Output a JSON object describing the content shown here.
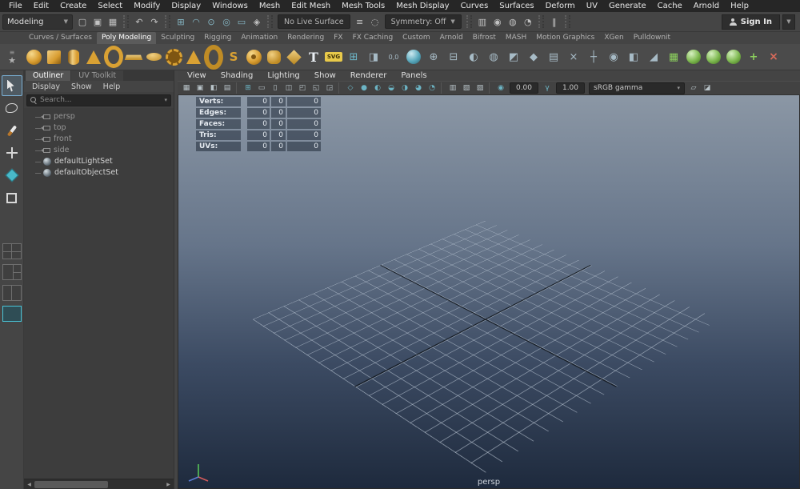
{
  "menubar": {
    "items": [
      "File",
      "Edit",
      "Create",
      "Select",
      "Modify",
      "Display",
      "Windows",
      "Mesh",
      "Edit Mesh",
      "Mesh Tools",
      "Mesh Display",
      "Curves",
      "Surfaces",
      "Deform",
      "UV",
      "Generate",
      "Cache",
      "Arnold",
      "Help"
    ]
  },
  "statusline": {
    "menu_set": "Modeling",
    "live_surface": "No Live Surface",
    "symmetry": "Symmetry: Off",
    "sign_in": "Sign In",
    "icons_a": [
      {
        "name": "new-scene-icon",
        "cls": "",
        "glyph": "▢"
      },
      {
        "name": "open-scene-icon",
        "cls": "",
        "glyph": "▣"
      },
      {
        "name": "save-scene-icon",
        "cls": "",
        "glyph": "▦"
      },
      {
        "name": "grip",
        "cls": "grip",
        "glyph": ""
      },
      {
        "name": "undo-icon",
        "cls": "",
        "glyph": "↶"
      },
      {
        "name": "redo-icon",
        "cls": "",
        "glyph": "↷"
      },
      {
        "name": "grip",
        "cls": "grip",
        "glyph": ""
      },
      {
        "name": "snap-to-grid-icon",
        "cls": "teal",
        "glyph": "⊞"
      },
      {
        "name": "snap-to-curve-icon",
        "cls": "teal",
        "glyph": "◠"
      },
      {
        "name": "snap-to-point-icon",
        "cls": "teal",
        "glyph": "⊙"
      },
      {
        "name": "snap-to-projected-center-icon",
        "cls": "teal",
        "glyph": "◎"
      },
      {
        "name": "snap-to-view-plane-icon",
        "cls": "teal",
        "glyph": "▭"
      },
      {
        "name": "make-live-icon",
        "cls": "",
        "glyph": "◈"
      },
      {
        "name": "grip",
        "cls": "grip",
        "glyph": ""
      }
    ],
    "icons_b": [
      {
        "name": "construction-history-icon",
        "cls": "",
        "glyph": "≡"
      },
      {
        "name": "selection-highlighting-icon",
        "cls": "",
        "glyph": "◌"
      }
    ],
    "icons_c": [
      {
        "name": "grip",
        "cls": "grip",
        "glyph": ""
      },
      {
        "name": "open-render-view-icon",
        "cls": "",
        "glyph": "▥"
      },
      {
        "name": "render-current-frame-icon",
        "cls": "",
        "glyph": "◉"
      },
      {
        "name": "ipr-render-icon",
        "cls": "",
        "glyph": "◍"
      },
      {
        "name": "render-settings-icon",
        "cls": "",
        "glyph": "◔"
      },
      {
        "name": "grip",
        "cls": "grip",
        "glyph": ""
      },
      {
        "name": "pause-viewport-icon",
        "cls": "",
        "glyph": "‖"
      },
      {
        "name": "grip",
        "cls": "grip",
        "glyph": ""
      }
    ]
  },
  "shelf": {
    "tabs": [
      {
        "label": "Curves / Surfaces",
        "cls": "",
        "name": "shelf-tab-curves-surfaces"
      },
      {
        "label": "Poly Modeling",
        "cls": "active",
        "name": "shelf-tab-poly-modeling"
      },
      {
        "label": "Sculpting",
        "cls": "",
        "name": "shelf-tab-sculpting"
      },
      {
        "label": "Rigging",
        "cls": "",
        "name": "shelf-tab-rigging"
      },
      {
        "label": "Animation",
        "cls": "",
        "name": "shelf-tab-animation"
      },
      {
        "label": "Rendering",
        "cls": "",
        "name": "shelf-tab-rendering"
      },
      {
        "label": "FX",
        "cls": "",
        "name": "shelf-tab-fx"
      },
      {
        "label": "FX Caching",
        "cls": "",
        "name": "shelf-tab-fx-caching"
      },
      {
        "label": "Custom",
        "cls": "",
        "name": "shelf-tab-custom"
      },
      {
        "label": "Arnold",
        "cls": "",
        "name": "shelf-tab-arnold"
      },
      {
        "label": "Bifrost",
        "cls": "",
        "name": "shelf-tab-bifrost"
      },
      {
        "label": "MASH",
        "cls": "",
        "name": "shelf-tab-mash"
      },
      {
        "label": "Motion Graphics",
        "cls": "",
        "name": "shelf-tab-motion-graphics"
      },
      {
        "label": "XGen",
        "cls": "",
        "name": "shelf-tab-xgen"
      },
      {
        "label": "Pulldownit",
        "cls": "",
        "name": "shelf-tab-pulldownit"
      }
    ],
    "icons": [
      {
        "name": "poly-sphere-icon",
        "cls": "gold ball",
        "glyph": ""
      },
      {
        "name": "poly-cube-icon",
        "cls": "gold cube",
        "glyph": ""
      },
      {
        "name": "poly-cylinder-icon",
        "cls": "gold cyl",
        "glyph": ""
      },
      {
        "name": "poly-cone-icon",
        "cls": "gold cone",
        "glyph": ""
      },
      {
        "name": "poly-torus-icon",
        "cls": "gold ring",
        "glyph": ""
      },
      {
        "name": "poly-plane-icon",
        "cls": "gold plane",
        "glyph": ""
      },
      {
        "name": "poly-disc-icon",
        "cls": "gold disc",
        "glyph": ""
      },
      {
        "name": "poly-gear-icon",
        "cls": "gold gear",
        "glyph": ""
      },
      {
        "name": "poly-pyramid-icon",
        "cls": "gold cone",
        "glyph": ""
      },
      {
        "name": "poly-pipe-icon",
        "cls": "gold pipe",
        "glyph": ""
      },
      {
        "name": "poly-helix-icon",
        "cls": "glyphgold",
        "glyph": "S"
      },
      {
        "name": "poly-soccer-ball-icon",
        "cls": "gold ball dotted",
        "glyph": ""
      },
      {
        "name": "poly-super-ellipse-icon",
        "cls": "gold squircle",
        "glyph": ""
      },
      {
        "name": "poly-platonic-solid-icon",
        "cls": "gold diam",
        "glyph": ""
      },
      {
        "name": "poly-type-icon",
        "cls": "typeicon",
        "glyph": "T"
      },
      {
        "name": "svg-create-icon",
        "cls": "svgbadge",
        "glyph": "SVG"
      },
      {
        "name": "construction-plane-icon",
        "cls": "tool teal",
        "glyph": "⊞"
      },
      {
        "name": "image-plane-icon",
        "cls": "tool",
        "glyph": "◨"
      },
      {
        "name": "move-to-origin-icon",
        "cls": "tool tiny",
        "glyph": "0,0"
      },
      {
        "name": "smooth-mesh-preview-icon",
        "cls": "tealball",
        "glyph": ""
      },
      {
        "name": "combine-icon",
        "cls": "tool",
        "glyph": "⊕"
      },
      {
        "name": "separate-icon",
        "cls": "tool",
        "glyph": "⊟"
      },
      {
        "name": "boolean-icon",
        "cls": "tool",
        "glyph": "◐"
      },
      {
        "name": "smooth-icon",
        "cls": "tool",
        "glyph": "◍"
      },
      {
        "name": "extrude-icon",
        "cls": "tool",
        "glyph": "◩"
      },
      {
        "name": "bevel-icon",
        "cls": "tool",
        "glyph": "◆"
      },
      {
        "name": "bridge-icon",
        "cls": "tool",
        "glyph": "▤"
      },
      {
        "name": "multi-cut-icon",
        "cls": "tool",
        "glyph": "×"
      },
      {
        "name": "connect-icon",
        "cls": "tool",
        "glyph": "┼"
      },
      {
        "name": "target-weld-icon",
        "cls": "tool",
        "glyph": "◉"
      },
      {
        "name": "mirror-icon",
        "cls": "tool",
        "glyph": "◧"
      },
      {
        "name": "crease-icon",
        "cls": "tool",
        "glyph": "◢"
      },
      {
        "name": "quad-draw-icon",
        "cls": "green",
        "glyph": "▦"
      },
      {
        "name": "sculpt-brush-icon",
        "cls": "green ball",
        "glyph": ""
      },
      {
        "name": "smooth-brush-icon",
        "cls": "green ball",
        "glyph": ""
      },
      {
        "name": "relax-brush-icon",
        "cls": "green ball",
        "glyph": ""
      },
      {
        "name": "grab-brush-icon",
        "cls": "green",
        "glyph": "+"
      },
      {
        "name": "delete-history-icon",
        "cls": "red",
        "glyph": "×"
      }
    ],
    "menu_button": "≡",
    "editor_button": "★"
  },
  "toolbox": {
    "tools": [
      {
        "name": "select-tool",
        "cls": "t-select active"
      },
      {
        "name": "lasso-select-tool",
        "cls": "t-lasso"
      },
      {
        "name": "paint-select-tool",
        "cls": "t-paint"
      },
      {
        "name": "move-tool",
        "cls": "t-move"
      },
      {
        "name": "rotate-tool",
        "cls": "t-rotate"
      },
      {
        "name": "scale-tool",
        "cls": "t-scale"
      }
    ],
    "layouts": [
      {
        "name": "layout-four-pane-button",
        "cls": "l-four"
      },
      {
        "name": "layout-three-pane-button",
        "cls": "l-three"
      },
      {
        "name": "layout-two-pane-button",
        "cls": "l-two"
      },
      {
        "name": "layout-single-pane-button",
        "cls": "l-single active"
      }
    ]
  },
  "outliner": {
    "tabs": [
      "Outliner",
      "UV Toolkit"
    ],
    "menus": [
      "Display",
      "Show",
      "Help"
    ],
    "search_placeholder": "Search...",
    "items": [
      {
        "label": "persp",
        "type": "camera"
      },
      {
        "label": "top",
        "type": "camera"
      },
      {
        "label": "front",
        "type": "camera"
      },
      {
        "label": "side",
        "type": "camera"
      },
      {
        "label": "defaultLightSet",
        "type": "set"
      },
      {
        "label": "defaultObjectSet",
        "type": "set"
      }
    ]
  },
  "viewport": {
    "menus": [
      "View",
      "Shading",
      "Lighting",
      "Show",
      "Renderer",
      "Panels"
    ],
    "toolbar_icons_a": [
      {
        "name": "select-camera-icon",
        "cls": "",
        "glyph": "▦"
      },
      {
        "name": "lock-camera-icon",
        "cls": "",
        "glyph": "▣"
      },
      {
        "name": "camera-attributes-icon",
        "cls": "",
        "glyph": "◧"
      },
      {
        "name": "bookmarks-icon",
        "cls": "",
        "glyph": "▤"
      },
      {
        "name": "sep",
        "cls": "sep",
        "glyph": ""
      },
      {
        "name": "grid-toggle-icon",
        "cls": "teal",
        "glyph": "⊞"
      },
      {
        "name": "film-gate-icon",
        "cls": "",
        "glyph": "▭"
      },
      {
        "name": "resolution-gate-icon",
        "cls": "",
        "glyph": "▯"
      },
      {
        "name": "gate-mask-icon",
        "cls": "",
        "glyph": "◫"
      },
      {
        "name": "field-chart-icon",
        "cls": "",
        "glyph": "◰"
      },
      {
        "name": "safe-action-icon",
        "cls": "",
        "glyph": "◱"
      },
      {
        "name": "safe-title-icon",
        "cls": "",
        "glyph": "◲"
      },
      {
        "name": "sep",
        "cls": "sep",
        "glyph": ""
      },
      {
        "name": "wireframe-icon",
        "cls": "teal",
        "glyph": "◇"
      },
      {
        "name": "smooth-shade-icon",
        "cls": "teal",
        "glyph": "●"
      },
      {
        "name": "textured-icon",
        "cls": "teal",
        "glyph": "◐"
      },
      {
        "name": "use-default-material-icon",
        "cls": "teal",
        "glyph": "◒"
      },
      {
        "name": "lighting-icon",
        "cls": "teal",
        "glyph": "◑"
      },
      {
        "name": "shadows-icon",
        "cls": "teal",
        "glyph": "◕"
      },
      {
        "name": "occlusion-icon",
        "cls": "teal",
        "glyph": "◔"
      },
      {
        "name": "sep",
        "cls": "sep",
        "glyph": ""
      },
      {
        "name": "isolate-select-icon",
        "cls": "",
        "glyph": "▥"
      },
      {
        "name": "xray-icon",
        "cls": "",
        "glyph": "▧"
      },
      {
        "name": "wireframe-on-shaded-icon",
        "cls": "",
        "glyph": "▨"
      },
      {
        "name": "sep",
        "cls": "sep",
        "glyph": ""
      }
    ],
    "toolbar_icons_b": [
      {
        "name": "grease-pencil-icon",
        "cls": "",
        "glyph": "▱"
      },
      {
        "name": "snapshot-icon",
        "cls": "",
        "glyph": "◪"
      }
    ],
    "exposure": "0.00",
    "gamma": "1.00",
    "color_management": "sRGB gamma",
    "camera_label": "persp",
    "hud_rows": [
      {
        "label": "Verts:",
        "v1": "0",
        "v2": "0",
        "v3": "0"
      },
      {
        "label": "Edges:",
        "v1": "0",
        "v2": "0",
        "v3": "0"
      },
      {
        "label": "Faces:",
        "v1": "0",
        "v2": "0",
        "v3": "0"
      },
      {
        "label": "Tris:",
        "v1": "0",
        "v2": "0",
        "v3": "0"
      },
      {
        "label": "UVs:",
        "v1": "0",
        "v2": "0",
        "v3": "0"
      }
    ]
  }
}
